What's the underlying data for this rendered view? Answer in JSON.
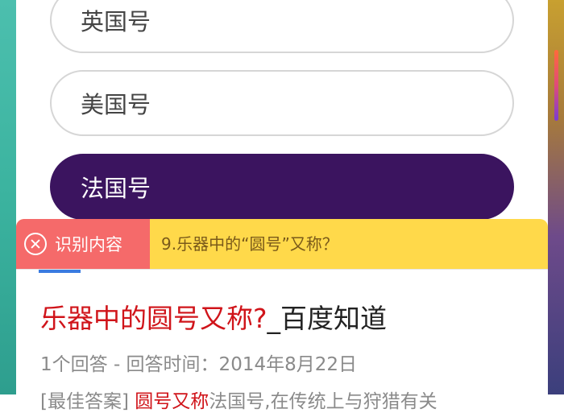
{
  "quiz": {
    "options": [
      {
        "label": "英国号",
        "selected": false
      },
      {
        "label": "美国号",
        "selected": false
      },
      {
        "label": "法国号",
        "selected": true
      }
    ]
  },
  "ocr_bar": {
    "close_icon": "close-circle-icon",
    "label": "识别内容",
    "recognized_text": "9.乐器中的“圆号”又称？"
  },
  "result": {
    "title_highlight": "乐器中的圆号又称?",
    "title_rest": "_百度知道",
    "meta": "1个回答 - 回答时间：2014年8月22日",
    "snippet_prefix": "[最佳答案] ",
    "snippet_highlight": "圆号又称",
    "snippet_rest": "法国号,在传统上与狩猎有关"
  },
  "colors": {
    "selected_option_bg": "#3b145f",
    "ocr_bar_bg": "#ffd94a",
    "ocr_label_bg": "#f56a6a",
    "highlight_red": "#d0141a"
  }
}
